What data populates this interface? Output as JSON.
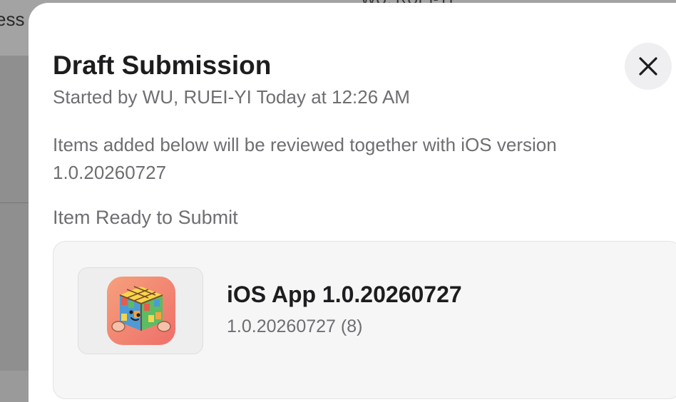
{
  "background": {
    "left_text": "ess",
    "top_text": "WU, RUEI-YI"
  },
  "sheet": {
    "title": "Draft Submission",
    "subtitle": "Started by WU, RUEI-YI Today at 12:26 AM",
    "description": "Items added below will be reviewed together with iOS version 1.0.20260727",
    "section_heading": "Item Ready to Submit",
    "close_icon": "close-icon"
  },
  "item": {
    "name": "iOS App 1.0.20260727",
    "build": "1.0.20260727 (8)",
    "icon": "rubiks-cube-app-icon"
  },
  "colors": {
    "accent_text": "#1d1d1f",
    "secondary_text": "#6e6e73",
    "sheet_bg": "#ffffff"
  }
}
